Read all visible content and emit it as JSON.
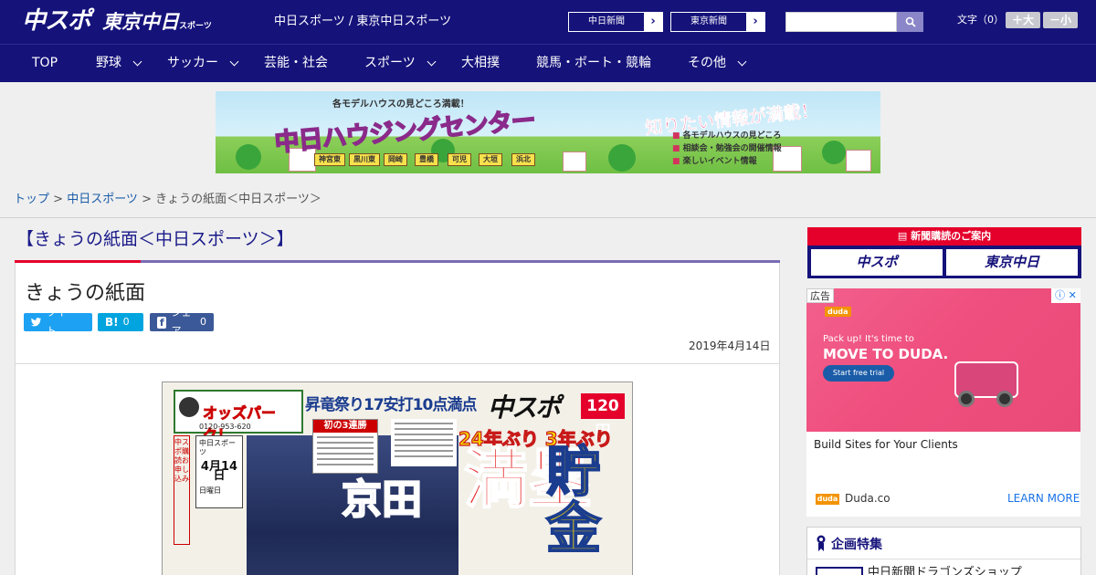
{
  "header": {
    "logo_main": "中スポ",
    "logo_tokyo": "東京中日",
    "logo_tokyo_small": "スポーツ",
    "site_title": "中日スポーツ / 東京中日スポーツ",
    "links": [
      {
        "label": "中日新聞"
      },
      {
        "label": "東京新聞"
      }
    ],
    "search": {
      "placeholder": "",
      "value": ""
    },
    "font_size_label": "文字（0）",
    "font_larger": "＋大",
    "font_smaller": "－小"
  },
  "nav": {
    "items": [
      {
        "label": "TOP",
        "has_dropdown": false
      },
      {
        "label": "野球",
        "has_dropdown": true
      },
      {
        "label": "サッカー",
        "has_dropdown": true
      },
      {
        "label": "芸能・社会",
        "has_dropdown": false
      },
      {
        "label": "スポーツ",
        "has_dropdown": true
      },
      {
        "label": "大相撲",
        "has_dropdown": false
      },
      {
        "label": "競馬・ボート・競輪",
        "has_dropdown": false
      },
      {
        "label": "その他",
        "has_dropdown": true
      }
    ]
  },
  "banner": {
    "top_text": "各モデルハウスの見どころ満載！",
    "main_text": "中日ハウジングセンター",
    "right_text": "知りたい情報が満載！",
    "list": [
      "各モデルハウスの見どころ",
      "相談会・勉強会の開催情報",
      "楽しいイベント情報"
    ],
    "cities": [
      "神宮東",
      "黒川東",
      "岡崎",
      "豊橋",
      "可児",
      "大垣",
      "浜北"
    ]
  },
  "breadcrumb": {
    "top": "トップ",
    "sep1": " > ",
    "section": "中日スポーツ",
    "sep2": " > ",
    "current": "きょうの紙面＜中日スポーツ＞"
  },
  "page_heading": "【きょうの紙面＜中日スポーツ＞】",
  "article": {
    "title": "きょうの紙面",
    "share": {
      "tweet": "ツイート",
      "hatena_icon": "B!",
      "hatena_count": "0",
      "fb_icon": "f",
      "fb_label": "シェア",
      "fb_count": "0"
    },
    "date": "2019年4月14日"
  },
  "front_page": {
    "odds_title": "オッズパーク！",
    "odds_tel": "0120-953-620",
    "headline": "昇竜祭り17安打10点満点",
    "logo": "中スポ",
    "price": "120円",
    "subhead": "24年ぶり  3年ぶり",
    "big1": "満塁",
    "big2": "貯金",
    "name": "京田",
    "box_title": "初の3連勝",
    "date_box_title": "中日スポーツ",
    "date_box_date": "4月14日",
    "date_box_day": "日曜日",
    "side_text": "中スポ購読お申し込み"
  },
  "sidebar": {
    "subscribe_head": "新聞購読のご案内",
    "subscribe_buttons": [
      "中スポ",
      "東京中日"
    ],
    "ad": {
      "label": "広告",
      "close": "ⓘ ✕",
      "duda_tag": "duda",
      "pack": "Pack up! It's time to",
      "move": "MOVE TO DUDA.",
      "trial": "Start free trial",
      "text": "Build Sites for Your Clients",
      "brand_badge": "duda",
      "brand": "Duda.co",
      "cta": "LEARN MORE"
    },
    "feature": {
      "title": "企画特集",
      "item": "中日新聞ドラゴンズショップ"
    }
  },
  "colors": {
    "brand_navy": "#15127a",
    "accent_red": "#e5002c",
    "accent_purple": "#7a6bb5",
    "twitter": "#1da1f2",
    "hatena": "#00a4de",
    "facebook": "#3b5998"
  }
}
